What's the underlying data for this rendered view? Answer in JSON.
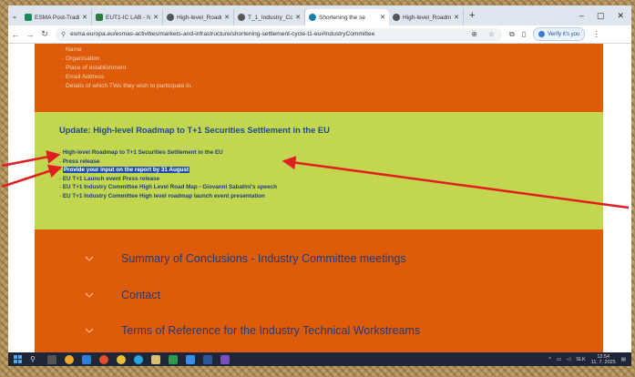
{
  "browser": {
    "tabs": [
      {
        "title": "ESMA Post-Tradin",
        "favicon_color": "#1b8a5a",
        "active": false
      },
      {
        "title": "EUT1-IC LAB - Nu",
        "favicon_color": "#2a7a3a",
        "active": false
      },
      {
        "title": "High-level_Roadm",
        "favicon_color": "#555555",
        "active": false
      },
      {
        "title": "T_1_Industry_Com",
        "favicon_color": "#555555",
        "active": false
      },
      {
        "title": "Shortening the se",
        "favicon_color": "#1a7fa8",
        "active": true
      },
      {
        "title": "High-level_Roadm",
        "favicon_color": "#555555",
        "active": false
      }
    ],
    "new_tab": "+",
    "window_controls": [
      "–",
      "▢",
      "✕"
    ],
    "url": "esma.europa.eu/esmas-activities/markets-and-infrastructure/shortening-settlement-cycle-t1-eu#IndustryCommittee",
    "verify_label": "Verify it's you"
  },
  "top_section": {
    "items": [
      "Name",
      "Organisation",
      "Place of establishment",
      "Email Address",
      "Details of which TWs they wish to participate in."
    ]
  },
  "update_section": {
    "heading": "Update: High-level Roadmap to T+1 Securities Settlement in the EU",
    "links": [
      "High-level Roadmap to T+1 Securities Settlement in the EU",
      "Press release",
      "Provide your input on the report by 31 August",
      "EU T+1 Launch event Press release",
      "EU T+1 Industry Committee High Level Road Map - Giovanni Sabatini's speech",
      "EU T+1 Industry Committee High level roadmap launch event presentation"
    ]
  },
  "accordion": [
    "Summary of Conclusions - Industry Committee meetings",
    "Contact",
    "Terms of Reference for the Industry Technical Workstreams"
  ],
  "taskbar": {
    "tray_language": "SLK",
    "time": "12:54",
    "date": "11. 7. 2025"
  },
  "colors": {
    "orange": "#de5c09",
    "green": "#c2d650",
    "link_blue": "#1d3f7a",
    "arrow_red": "#e02020"
  }
}
